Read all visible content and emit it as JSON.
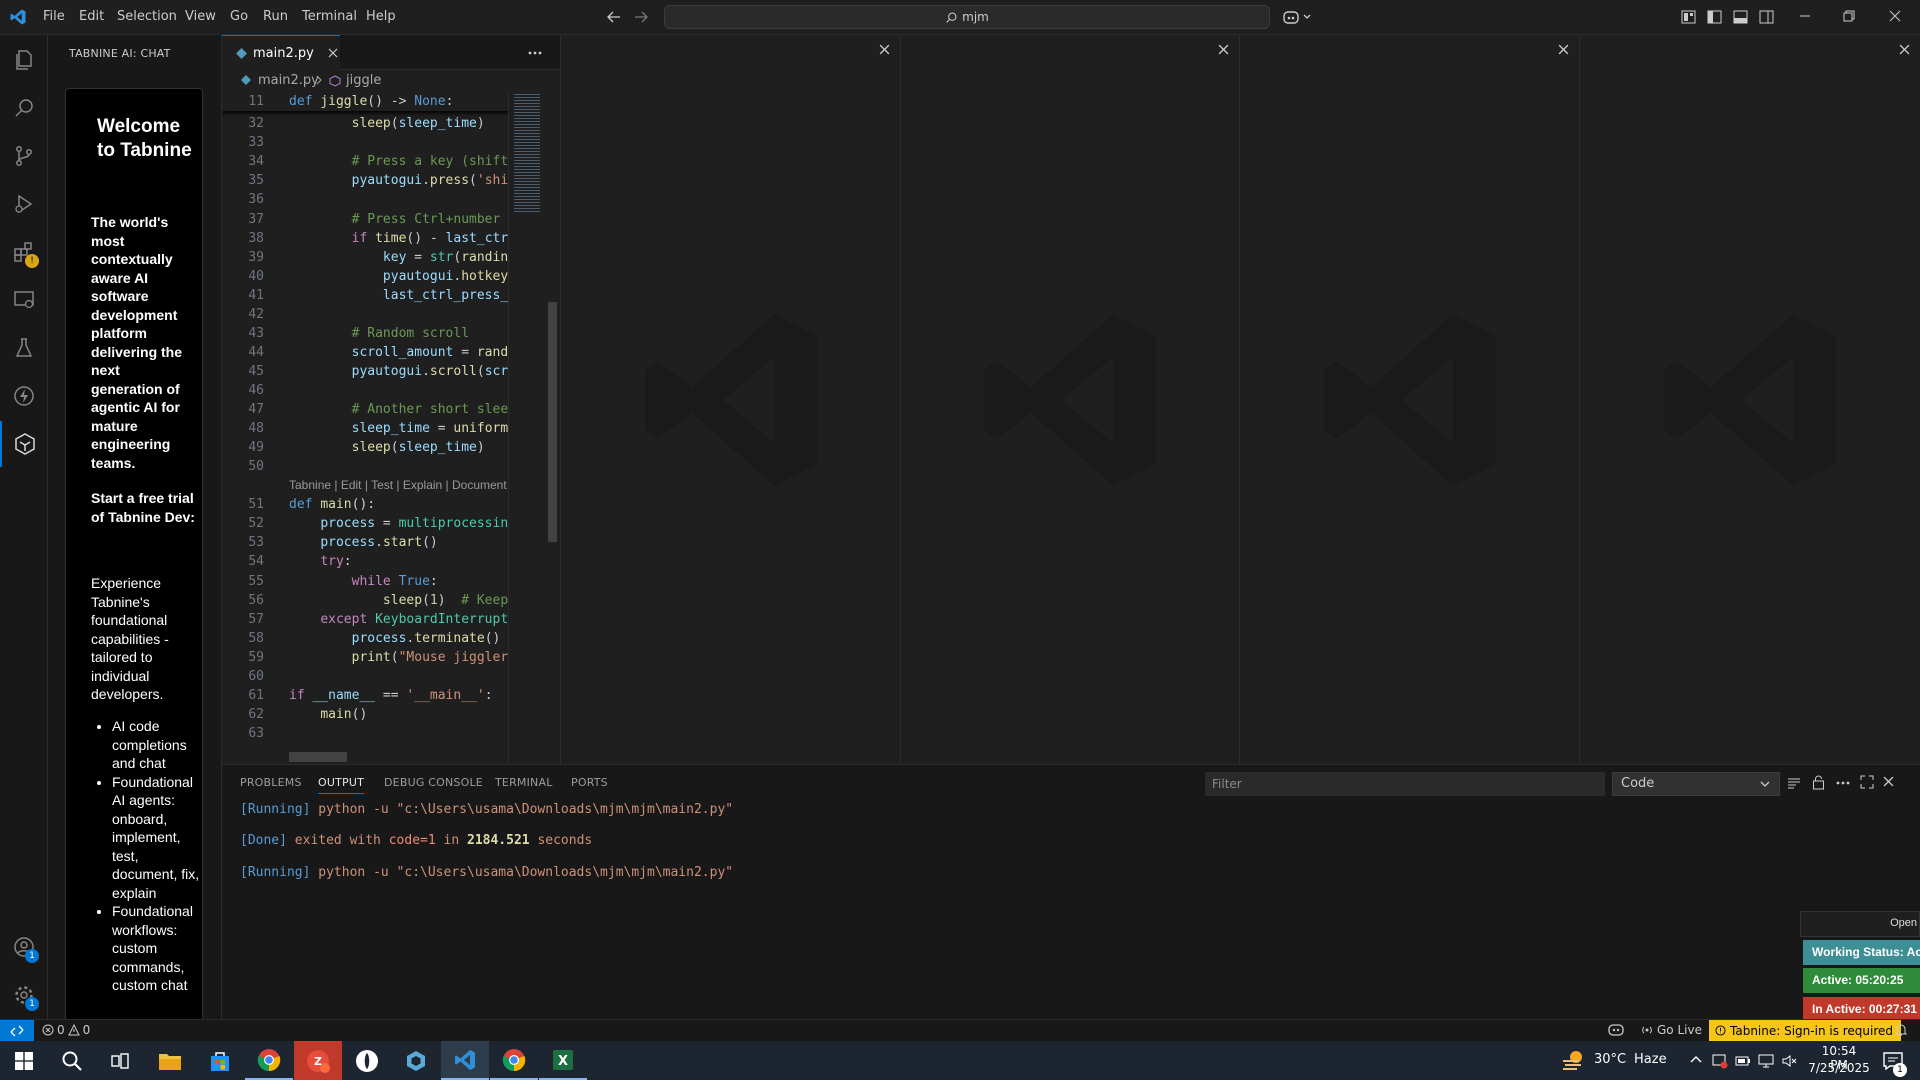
{
  "titlebar": {
    "menu": [
      "File",
      "Edit",
      "Selection",
      "View",
      "Go",
      "Run",
      "Terminal",
      "Help"
    ],
    "search_text": "mjm"
  },
  "sidebar": {
    "title": "TABNINE AI: CHAT",
    "welcome_title": "Welcome to Tabnine",
    "intro": "The world's most contextually aware AI software development platform delivering the next generation of agentic AI for mature engineering teams.",
    "trial": "Start a free trial of Tabnine Dev:",
    "experience": "Experience Tabnine's foundational capabilities - tailored to individual developers.",
    "bullets": [
      "AI code completions and chat",
      "Foundational AI agents: onboard, implement, test, document, fix, explain",
      "Foundational workflows: custom commands, custom chat"
    ]
  },
  "editor": {
    "tab_label": "main2.py",
    "breadcrumb_file": "main2.py",
    "breadcrumb_symbol": "jiggle",
    "codelens": "Tabnine | Edit | Test | Explain | Document"
  },
  "panel": {
    "tabs": [
      "PROBLEMS",
      "OUTPUT",
      "DEBUG CONSOLE",
      "TERMINAL",
      "PORTS"
    ],
    "filter_placeholder": "Filter",
    "channel": "Code",
    "lines": [
      {
        "tag": "[Running]",
        "text": " python -u \"c:\\Users\\usama\\Downloads\\mjm\\mjm\\main2.py\""
      },
      {
        "tag": "[Done]",
        "text": " exited with ",
        "code": "code=1",
        "mid": " in ",
        "secs": "2184.521",
        "end": " seconds"
      },
      {
        "tag": "[Running]",
        "text": " python -u \"c:\\Users\\usama\\Downloads\\mjm\\mjm\\main2.py\""
      }
    ]
  },
  "statusbar": {
    "errors": "0",
    "warnings": "0",
    "golive": "Go Live",
    "tabnine": "Tabnine: Sign-in is required"
  },
  "widget": {
    "open": "Open",
    "working": "Working Status: Ac",
    "active": "Active: 05:20:25",
    "inactive": "In Active: 00:27:31"
  },
  "taskbar": {
    "weather_temp": "30°C",
    "weather_desc": "Haze",
    "time": "10:54 PM",
    "date": "7/25/2025",
    "notif_count": "1"
  },
  "colors": {
    "accent": "#0078d4",
    "working": "#3e8e95",
    "active": "#2e8b3a",
    "inactive": "#c0392b",
    "tabnine_status": "#e6b422"
  }
}
